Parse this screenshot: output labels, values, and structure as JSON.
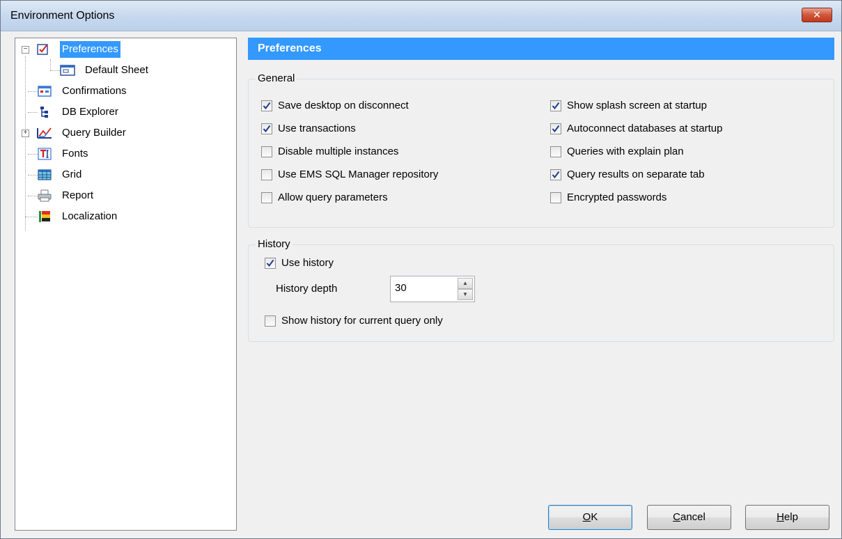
{
  "window": {
    "title": "Environment Options",
    "close_label": "✕"
  },
  "tree": {
    "items": [
      {
        "label": "Preferences",
        "icon": "checkbox-icon",
        "selected": true,
        "expander": "minus"
      },
      {
        "label": "Default Sheet",
        "icon": "sheet-icon"
      },
      {
        "label": "Confirmations",
        "icon": "confirmations-icon"
      },
      {
        "label": "DB Explorer",
        "icon": "tree-structure-icon"
      },
      {
        "label": "Query Builder",
        "icon": "query-builder-icon",
        "expander": "plus"
      },
      {
        "label": "Fonts",
        "icon": "font-icon"
      },
      {
        "label": "Grid",
        "icon": "grid-icon"
      },
      {
        "label": "Report",
        "icon": "printer-icon"
      },
      {
        "label": "Localization",
        "icon": "flag-icon"
      }
    ]
  },
  "panel": {
    "header": "Preferences",
    "general": {
      "title": "General",
      "left": [
        {
          "label": "Save desktop on disconnect",
          "checked": true
        },
        {
          "label": "Use transactions",
          "checked": true
        },
        {
          "label": "Disable multiple instances",
          "checked": false
        },
        {
          "label": "Use EMS SQL Manager repository",
          "checked": false
        },
        {
          "label": "Allow query parameters",
          "checked": false
        }
      ],
      "right": [
        {
          "label": "Show splash screen at startup",
          "checked": true
        },
        {
          "label": "Autoconnect databases at startup",
          "checked": true
        },
        {
          "label": "Queries with explain plan",
          "checked": false
        },
        {
          "label": "Query results on separate tab",
          "checked": true
        },
        {
          "label": "Encrypted passwords",
          "checked": false
        }
      ]
    },
    "history": {
      "title": "History",
      "use_history": {
        "label": "Use history",
        "checked": true
      },
      "depth_label": "History depth",
      "depth_value": "30",
      "current_only": {
        "label": "Show history for current query only",
        "checked": false
      }
    }
  },
  "buttons": {
    "ok": {
      "underline": "O",
      "rest": "K"
    },
    "cancel": {
      "underline": "C",
      "rest": "ancel"
    },
    "help": {
      "underline": "H",
      "rest": "elp"
    }
  },
  "colors": {
    "selection": "#3399ff",
    "check": "#1f3d8f"
  }
}
